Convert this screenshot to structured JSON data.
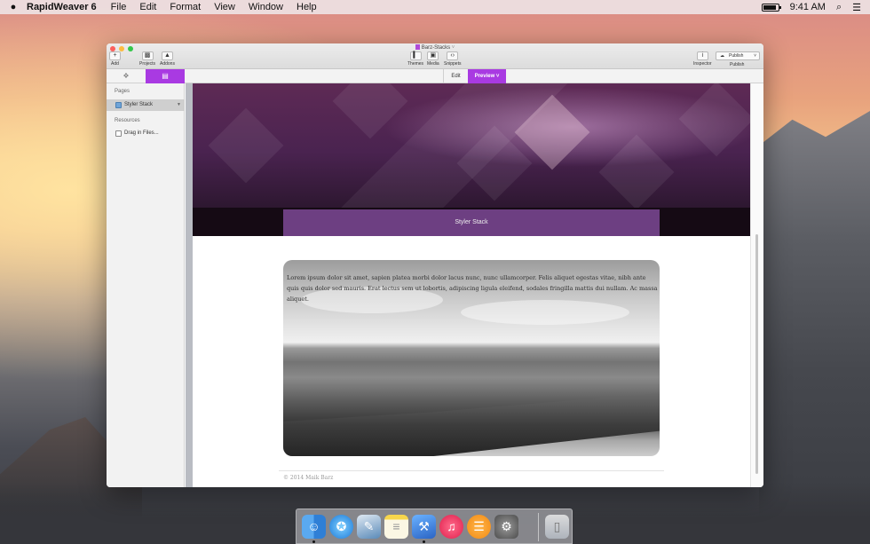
{
  "menubar": {
    "app_name": "RapidWeaver 6",
    "items": [
      "File",
      "Edit",
      "Format",
      "View",
      "Window",
      "Help"
    ],
    "battery_level": 0.9,
    "clock": "9:41 AM"
  },
  "window": {
    "title": "Barz-Stacks",
    "toolbar": {
      "add": "Add",
      "projects": "Projects",
      "addons": "Addons",
      "themes": "Themes",
      "media": "Media",
      "snippets": "Snippets",
      "inspector": "Inspector",
      "publish_button": "Publish",
      "publish_label": "Publish"
    },
    "modes": {
      "edit": "Edit",
      "preview": "Preview"
    },
    "sidebar": {
      "pages_heading": "Pages",
      "pages": [
        {
          "label": "Styler Stack"
        }
      ],
      "resources_heading": "Resources",
      "resources": [
        {
          "label": "Drag in Files..."
        }
      ]
    },
    "preview": {
      "banner_title": "Styler Stack",
      "body_text": "Lorem ipsum dolor sit amet, sapien platea morbi dolor lacus nunc, nunc ullamcorper. Felis aliquet egestas vitae, nibh ante quis quis dolor sed mauris. Erat lectus sem ut lobortis, adipiscing ligula eleifend, sodales fringilla mattis dui nullam. Ac massa aliquet.",
      "footer": "© 2014 Maik Barz"
    }
  },
  "dock": {
    "icons": [
      "finder-icon",
      "safari-icon",
      "preview-icon",
      "notes-icon",
      "xcode-icon",
      "itunes-icon",
      "ibooks-icon",
      "system-preferences-icon",
      "trash-icon"
    ]
  },
  "colors": {
    "accent": "#a93ae2",
    "title_box": "#6d3f82"
  }
}
